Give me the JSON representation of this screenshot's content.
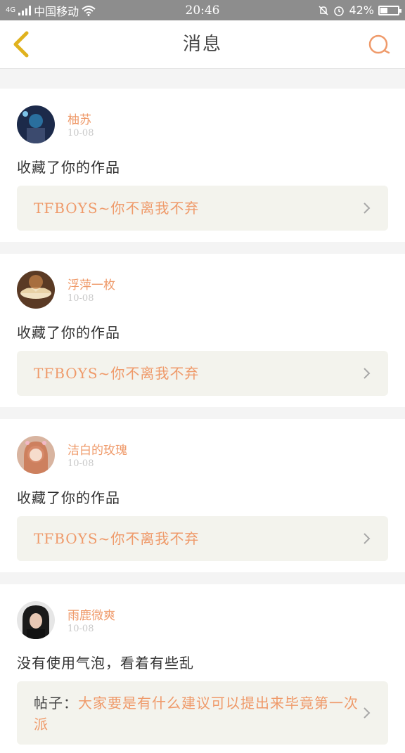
{
  "status_bar": {
    "carrier": "中国移动",
    "network": "4G",
    "time": "20:46",
    "battery": "42%",
    "battery_level": 0.42
  },
  "header": {
    "title": "消息",
    "back_icon": "chevron-left-icon",
    "search_icon": "search-icon"
  },
  "colors": {
    "accent": "#ef9a6a",
    "back_icon": "#e0b21e",
    "status_bar": "#8d8d8d"
  },
  "messages": [
    {
      "user": "柚苏",
      "time": "10-08",
      "action": "收藏了你的作品",
      "work_prefix": "",
      "work_title": "TFBOYS~你不离我不弃"
    },
    {
      "user": "浮萍一枚",
      "time": "10-08",
      "action": "收藏了你的作品",
      "work_prefix": "",
      "work_title": "TFBOYS~你不离我不弃"
    },
    {
      "user": "洁白的玫瑰",
      "time": "10-08",
      "action": "收藏了你的作品",
      "work_prefix": "",
      "work_title": "TFBOYS~你不离我不弃"
    },
    {
      "user": "雨鹿微爽",
      "time": "10-08",
      "action": "没有使用气泡，看着有些乱",
      "work_prefix": "帖子：",
      "work_title": "大家要是有什么建议可以提出来毕竟第一次派"
    }
  ]
}
